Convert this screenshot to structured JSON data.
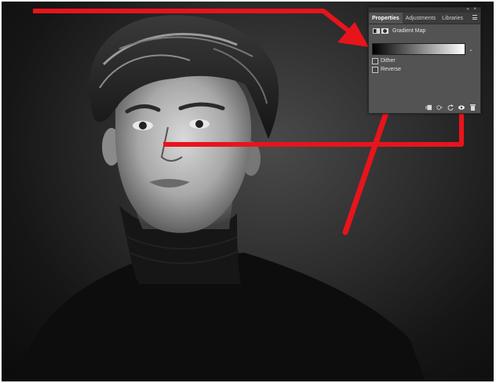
{
  "panel": {
    "tabs": [
      "Properties",
      "Adjustments",
      "Libraries"
    ],
    "active_tab": "Properties",
    "top_controls": "«  ×",
    "adjustment_title": "Gradient Map",
    "gradient": {
      "start_color": "#000000",
      "end_color": "#ffffff"
    },
    "options": [
      {
        "label": "Dither",
        "checked": false
      },
      {
        "label": "Reverse",
        "checked": false
      }
    ],
    "footer_icons": [
      "clip-to-layer-icon",
      "view-previous-state-icon",
      "reset-icon",
      "visibility-eye-icon",
      "trash-icon"
    ],
    "dropdown_glyph": "⌄"
  },
  "annotation": {
    "arrow_color": "#e8141c"
  }
}
